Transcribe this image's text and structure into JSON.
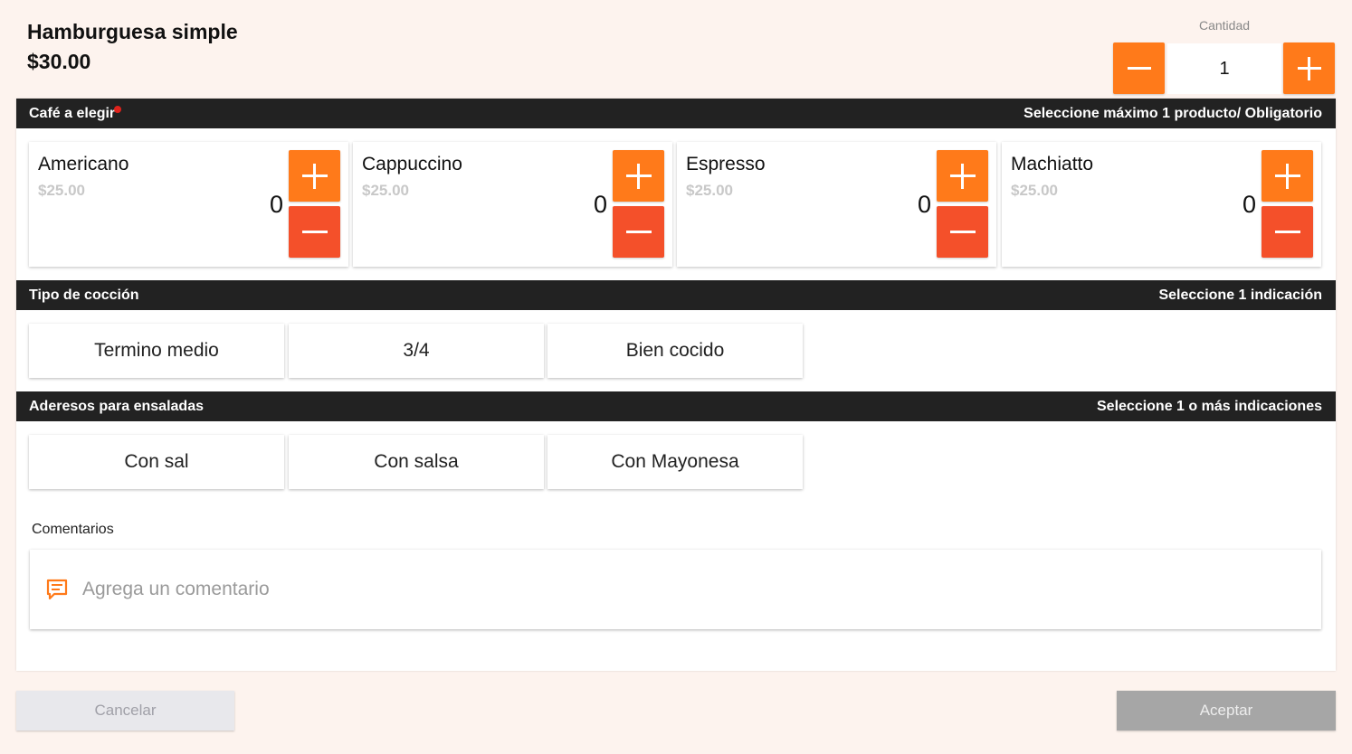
{
  "product": {
    "name": "Hamburguesa simple",
    "price": "$30.00"
  },
  "quantity": {
    "label": "Cantidad",
    "value": "1",
    "decrement_icon": "minus-icon",
    "increment_icon": "plus-icon"
  },
  "sections": {
    "coffee": {
      "title": "Café a elegir",
      "rule": "Seleccione máximo 1 producto/ Obligatorio",
      "required_dot_color": "#e0231c",
      "items": [
        {
          "name": "Americano",
          "price": "$25.00",
          "count": "0"
        },
        {
          "name": "Cappuccino",
          "price": "$25.00",
          "count": "0"
        },
        {
          "name": "Espresso",
          "price": "$25.00",
          "count": "0"
        },
        {
          "name": "Machiatto",
          "price": "$25.00",
          "count": "0"
        }
      ]
    },
    "cooking": {
      "title": "Tipo de cocción",
      "rule": "Seleccione 1 indicación",
      "options": [
        "Termino medio",
        "3/4",
        "Bien cocido"
      ]
    },
    "dressings": {
      "title": "Aderesos para ensaladas",
      "rule": "Seleccione 1 o más indicaciones",
      "options": [
        "Con sal",
        "Con salsa",
        "Con Mayonesa"
      ]
    }
  },
  "comments": {
    "label": "Comentarios",
    "placeholder": "Agrega un comentario",
    "icon": "comment-icon"
  },
  "actions": {
    "cancel_label": "Cancelar",
    "accept_label": "Aceptar"
  },
  "colors": {
    "accent": "#ff7a1a",
    "decrement": "#f4502a",
    "section_bar": "#222222",
    "background": "#fdf3ee"
  }
}
